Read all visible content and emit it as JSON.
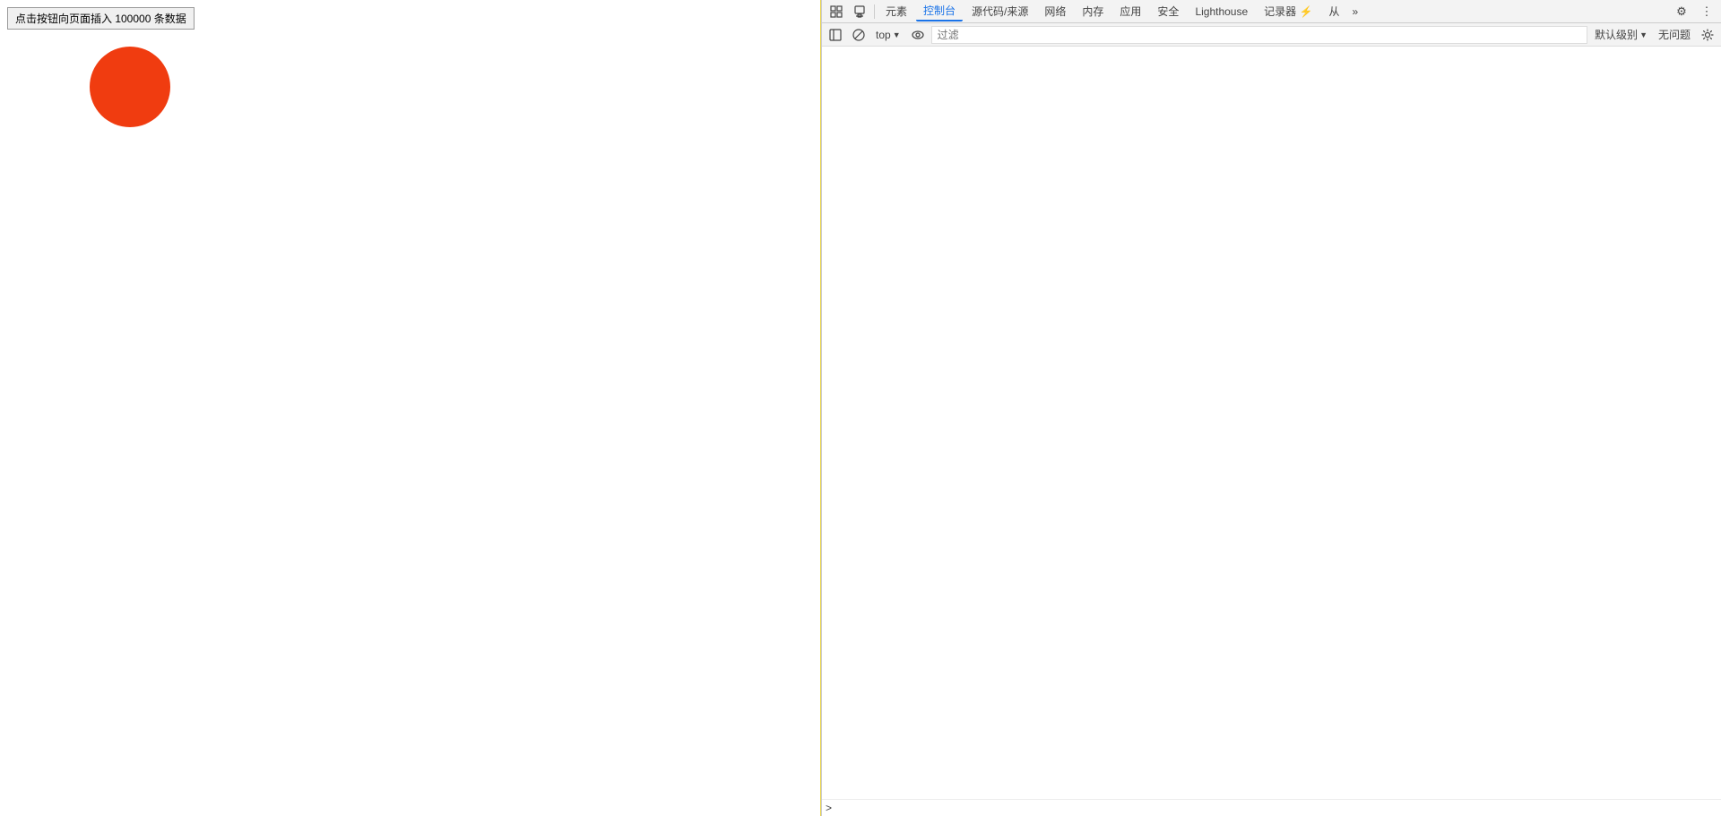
{
  "webpage": {
    "button_label": "点击按钮向页面插入 100000 条数据"
  },
  "devtools": {
    "tabs": [
      {
        "id": "inspect-icon",
        "type": "icon",
        "unicode": "⬚"
      },
      {
        "id": "device-icon",
        "type": "icon",
        "unicode": "▭"
      },
      {
        "label": "元素",
        "active": false
      },
      {
        "label": "控制台",
        "active": true
      },
      {
        "label": "源代码/来源",
        "active": false
      },
      {
        "label": "网络",
        "active": false
      },
      {
        "label": "内存",
        "active": false
      },
      {
        "label": "应用",
        "active": false
      },
      {
        "label": "安全",
        "active": false
      },
      {
        "label": "Lighthouse",
        "active": false
      },
      {
        "label": "记录器 ⚡",
        "active": false
      },
      {
        "label": "从",
        "active": false
      }
    ],
    "toolbar_right": {
      "settings_unicode": "⚙",
      "more_unicode": "⋮"
    },
    "console": {
      "clear_icon": "🚫",
      "top_label": "top",
      "eye_unicode": "👁",
      "filter_placeholder": "过滤",
      "level_label": "默认级别",
      "no_issues_label": "无问题",
      "settings_unicode": "⚙",
      "prompt_symbol": ">"
    }
  }
}
